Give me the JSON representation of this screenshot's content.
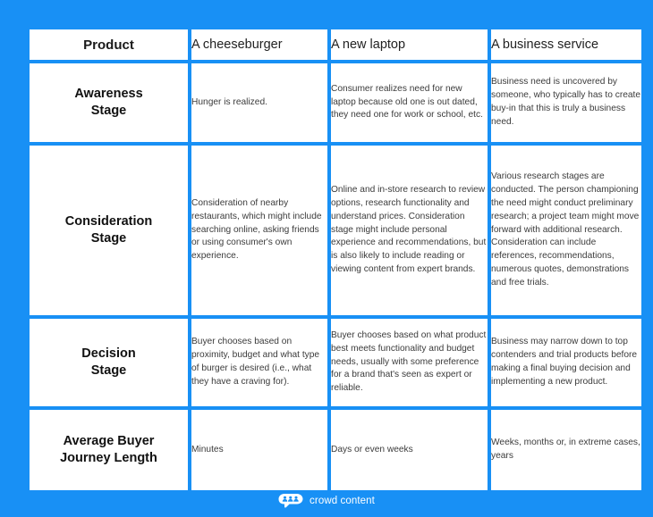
{
  "theme": {
    "background_blue": "#1890f5",
    "cell_background": "#ffffff",
    "heading_text": "#1a1a1a",
    "body_text": "#3b3b3b",
    "footer_text": "#ffffff"
  },
  "table": {
    "header": {
      "label": "Product",
      "columns": [
        "A cheeseburger",
        "A new laptop",
        "A business service"
      ]
    },
    "rows": [
      {
        "label": "Awareness\nStage",
        "label_lines": [
          "Awareness",
          "Stage"
        ],
        "cells": [
          "Hunger is realized.",
          "Consumer realizes need for new laptop because old one is out dated, they need one for work or school, etc.",
          "Business need is uncovered by someone, who typically has to create buy-in that this is truly a business need."
        ]
      },
      {
        "label": "Consideration\nStage",
        "label_lines": [
          "Consideration",
          "Stage"
        ],
        "cells": [
          "Consideration of nearby restaurants, which might include searching online, asking friends or using consumer's own experience.",
          "Online and in-store research to review options, research functionality and understand prices. Consideration stage might include personal experience and recommendations, but is also likely to include reading or viewing content from expert brands.",
          "Various research stages are conducted. The person championing the need might conduct preliminary research; a project team might move forward with additional research. Consideration can include references, recommendations, numerous quotes, demonstrations and free trials."
        ]
      },
      {
        "label": "Decision\nStage",
        "label_lines": [
          "Decision",
          "Stage"
        ],
        "cells": [
          "Buyer chooses based on proximity, budget and what type of burger is desired (i.e., what they have a craving for).",
          "Buyer chooses based on what product best meets functionality and budget needs, usually with some preference for a brand that's seen as expert or reliable.",
          "Business may narrow down to top contenders and trial products before making a final buying decision and implementing a new product."
        ]
      },
      {
        "label": "Average Buyer\nJourney Length",
        "label_lines": [
          "Average Buyer",
          "Journey Length"
        ],
        "cells": [
          "Minutes",
          "Days or even weeks",
          "Weeks, months or, in extreme cases, years"
        ]
      }
    ]
  },
  "footer": {
    "logo_icon": "crowd-content-speech-bubble-icon",
    "brand": "crowd content"
  }
}
